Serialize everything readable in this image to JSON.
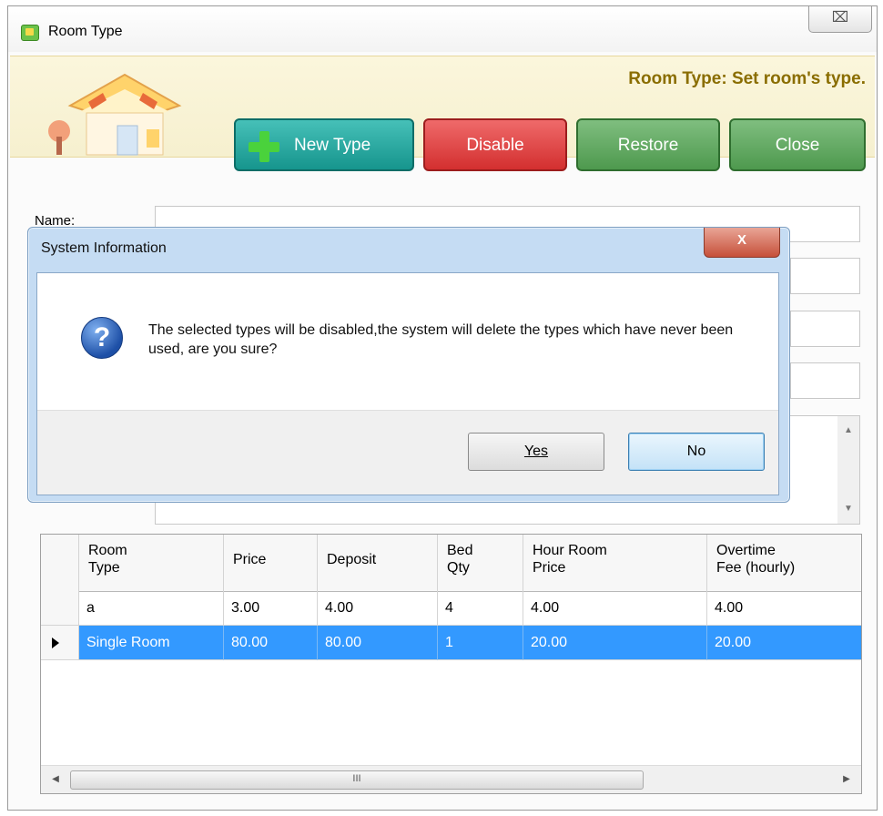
{
  "window": {
    "title": "Room Type",
    "close_glyph": "⌧"
  },
  "banner": {
    "caption": "Room Type: Set room's type.",
    "buttons": {
      "new_type": "New Type",
      "disable": "Disable",
      "restore": "Restore",
      "close": "Close"
    }
  },
  "form": {
    "name_label": "Name:"
  },
  "grid": {
    "columns": [
      "Room\nType",
      "Price",
      "Deposit",
      "Bed\nQty",
      "Hour Room\nPrice",
      "Overtime\nFee (hourly)"
    ],
    "rows": [
      {
        "room_type": "a",
        "price": "3.00",
        "deposit": "4.00",
        "bed_qty": "4",
        "hour_price": "4.00",
        "overtime": "4.00",
        "selected": false
      },
      {
        "room_type": "Single Room",
        "price": "80.00",
        "deposit": "80.00",
        "bed_qty": "1",
        "hour_price": "20.00",
        "overtime": "20.00",
        "selected": true
      }
    ],
    "scroll_thumb_glyph": "III"
  },
  "dialog": {
    "title": "System Information",
    "close_glyph": "X",
    "message": "The selected types will be disabled,the system will delete the types which have never been used, are you sure?",
    "yes_label": "Yes",
    "no_label": "No"
  },
  "colors": {
    "selection": "#3399ff",
    "new_type_button": "#1ea49b",
    "disable_button": "#d83a3a",
    "restore_button": "#5aa55a",
    "banner_caption": "#8a6d00"
  }
}
